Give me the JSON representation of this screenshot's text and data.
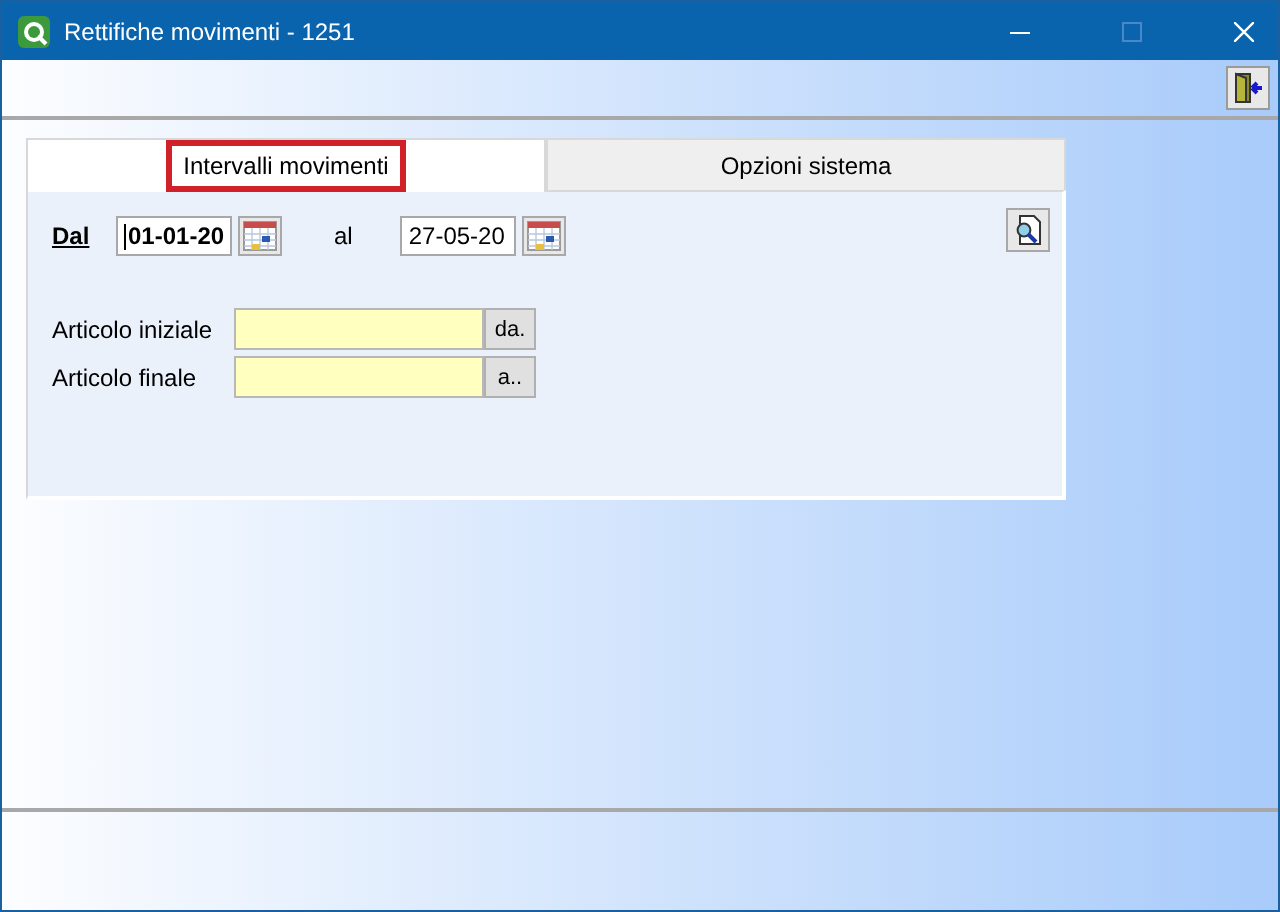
{
  "window": {
    "title": "Rettifiche movimenti - 1251"
  },
  "tabs": [
    {
      "label": "Intervalli movimenti",
      "selected": true
    },
    {
      "label": "Opzioni sistema",
      "selected": false
    }
  ],
  "date_from": {
    "label": "Dal",
    "value": "01-01-20"
  },
  "date_to": {
    "label": "al",
    "value": "27-05-20"
  },
  "articles": [
    {
      "label": "Articolo iniziale",
      "button": "da."
    },
    {
      "label": "Articolo finale",
      "button": "a.."
    }
  ]
}
